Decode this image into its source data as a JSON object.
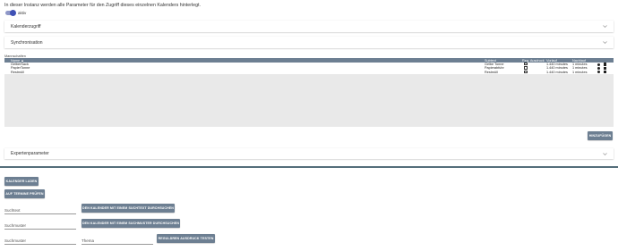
{
  "intro_text": "In dieser Instanz werden alle Parameter für den Zugriff dieses einzelnen Kalenders hinterlegt.",
  "toggle": {
    "label": "aktiv",
    "checked": true
  },
  "panels": {
    "kalenderzugriff": "Kalenderzugriff",
    "synchronisation": "Synchronisation",
    "expertenparameter": "Expertenparameter"
  },
  "mapping": {
    "label": "Mannschaften",
    "columns": {
      "name": "Name ▲",
      "subtext": "Subtext",
      "reg_ausdruck": "Reg. Ausdruck",
      "vorlauf": "Vorlauf",
      "nachlauf": "Nachlauf"
    },
    "rows": [
      {
        "name": "GelberSack",
        "subtext": "Gelbe Tonne",
        "reg": false,
        "vorlauf": "1.440 minutes",
        "nachlauf": "1 minutes"
      },
      {
        "name": "PapierTonne",
        "subtext": "Papierabfuhr",
        "reg": false,
        "vorlauf": "1.440 minutes",
        "nachlauf": "1 minutes"
      },
      {
        "name": "Restmüll",
        "subtext": "Restmüll",
        "reg": false,
        "vorlauf": "1.440 minutes",
        "nachlauf": "1 minutes"
      }
    ],
    "add_button": "HINZUFÜGEN"
  },
  "buttons": {
    "kalender_laden": "KALENDER LADEN",
    "auf_termine_pruefen": "AUF TERMINE PRÜFEN",
    "suchtext_durchsuchen": "DEN KALENDER MIT EINEM SUCHTEXT DURCHSUCHEN",
    "suchmuster_durchsuchen": "DEN KALENDER MIT EINEM SUCHMUSTER DURCHSUCHEN",
    "regulaeren_ausdruck_testen": "REGULÄREN AUSDRUCK TESTEN"
  },
  "fields": {
    "suchtext": "Suchtext",
    "suchmuster_1": "Suchmuster",
    "suchmuster_2": "Suchmuster",
    "thema": "Thema"
  }
}
